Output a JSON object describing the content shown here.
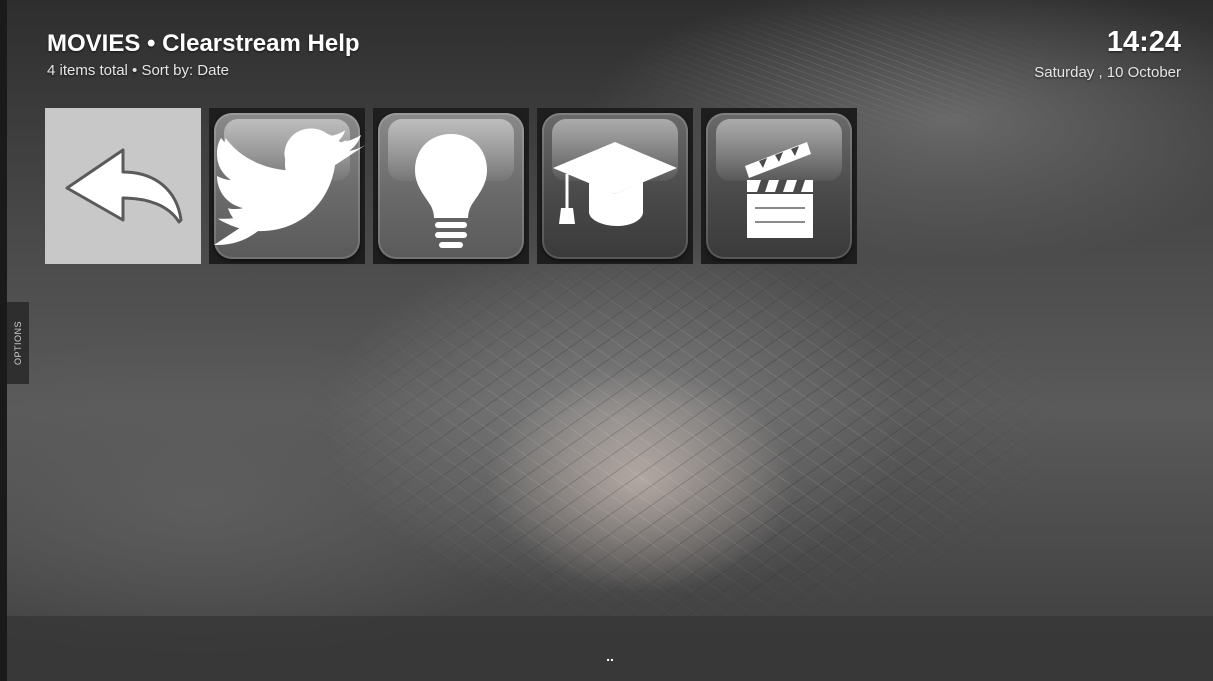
{
  "header": {
    "title": "MOVIES • Clearstream Help",
    "subtitle": "4 items total • Sort by: Date",
    "clock": "14:24",
    "date": "Saturday , 10 October"
  },
  "side_tab": {
    "label": "OPTIONS"
  },
  "tiles": [
    {
      "icon": "back-arrow-icon",
      "focused": true
    },
    {
      "icon": "twitter-bird-icon"
    },
    {
      "icon": "lightbulb-icon"
    },
    {
      "icon": "graduation-cap-icon"
    },
    {
      "icon": "clapperboard-icon"
    }
  ],
  "bottom_bar": {
    "label": ".."
  },
  "colors": {
    "focus": "#c8c8c8",
    "tile_bg": "#1e1e1e",
    "text": "#ffffff"
  }
}
